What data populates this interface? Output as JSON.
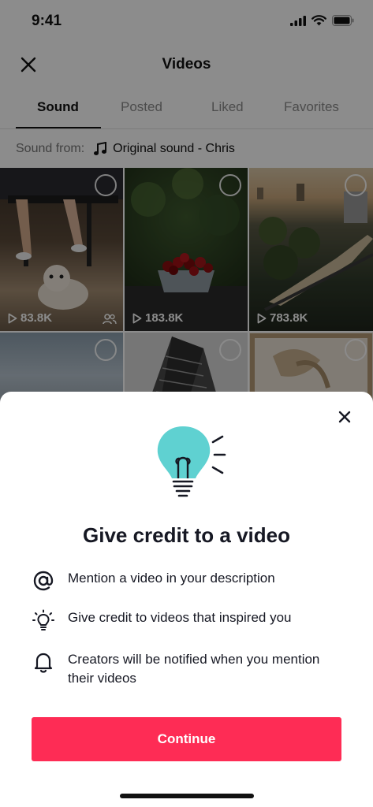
{
  "status_bar": {
    "time": "9:41"
  },
  "header": {
    "title": "Videos"
  },
  "tabs": [
    {
      "label": "Sound",
      "active": true
    },
    {
      "label": "Posted",
      "active": false
    },
    {
      "label": "Liked",
      "active": false
    },
    {
      "label": "Favorites",
      "active": false
    }
  ],
  "sound": {
    "from_label": "Sound from:",
    "name": "Original sound - Chris"
  },
  "videos": [
    {
      "plays": "83.8K",
      "scene": "dog under table",
      "duet": true
    },
    {
      "plays": "183.8K",
      "scene": "bowl of cherries",
      "duet": false
    },
    {
      "plays": "783.8K",
      "scene": "city train at sunset",
      "duet": false
    },
    {
      "plays": "",
      "scene": "cloudy sky",
      "duet": false
    },
    {
      "plays": "",
      "scene": "skyscraper",
      "duet": false
    },
    {
      "plays": "",
      "scene": "framed artwork",
      "duet": false
    }
  ],
  "sheet": {
    "title": "Give credit to a video",
    "items": [
      {
        "icon": "at-icon",
        "text": "Mention a video in your description"
      },
      {
        "icon": "lightbulb-icon",
        "text": "Give credit to videos that inspired you"
      },
      {
        "icon": "bell-icon",
        "text": "Creators will be notified when you mention their videos"
      }
    ],
    "button_label": "Continue"
  },
  "colors": {
    "accent": "#fe2c55",
    "bulb": "#5fd1d1",
    "text": "#161823"
  }
}
